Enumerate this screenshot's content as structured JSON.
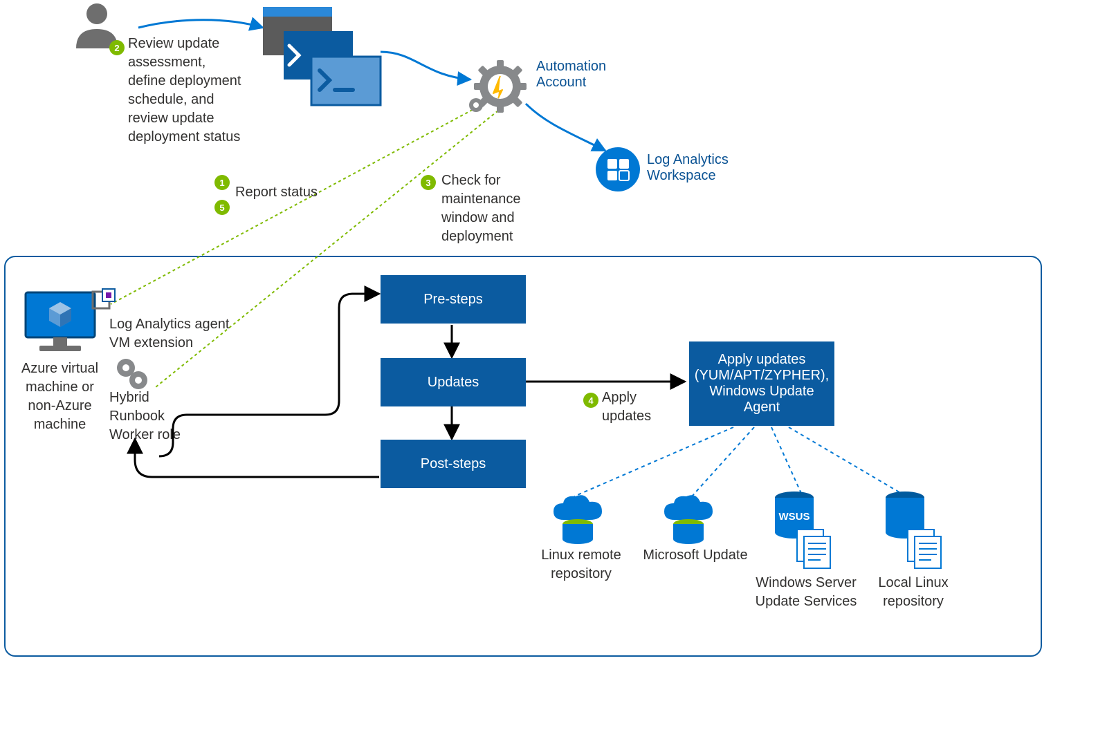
{
  "diagram": {
    "step2": "Review update assessment, define deployment schedule, and review update deployment status",
    "step1_5_label": "Report status",
    "step3": "Check for maintenance window and deployment",
    "step4": "Apply updates",
    "automationAccount": "Automation Account",
    "logWorkspace": "Log Analytics Workspace",
    "vmLabel": "Azure virtual machine or non-Azure machine",
    "laAgent": "Log Analytics agent VM extension",
    "hybridWorker": "Hybrid Runbook Worker role",
    "preSteps": "Pre-steps",
    "updates": "Updates",
    "postSteps": "Post-steps",
    "applyUpdatesBox": "Apply updates (YUM/APT/ZYPHER), Windows Update Agent",
    "linuxRemote": "Linux remote repository",
    "msUpdate": "Microsoft Update",
    "wsus": "Windows Server Update Services",
    "wsusBadge": "WSUS",
    "localLinux": "Local Linux repository",
    "badges": {
      "n1": "1",
      "n2": "2",
      "n3": "3",
      "n4": "4",
      "n5": "5"
    }
  }
}
